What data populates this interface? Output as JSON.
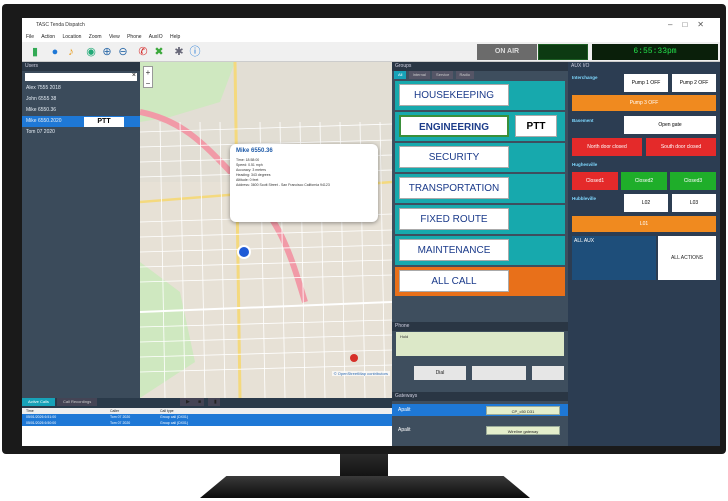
{
  "window": {
    "title": "TASC Tenda Dispatch"
  },
  "menu": [
    "File",
    "Action",
    "Location",
    "Zoom",
    "View",
    "Phone",
    "AuxIO",
    "Help"
  ],
  "toolbar": {
    "on_air": "ON AIR",
    "clock": "6:55:33pm"
  },
  "users": {
    "header": "Users",
    "items": [
      {
        "label": "Alex 7555 2018"
      },
      {
        "label": "John 6555 38"
      },
      {
        "label": "Mike 6550.36"
      },
      {
        "label": "Mike 6550.2020"
      },
      {
        "label": "Tom 07 2020"
      }
    ],
    "ptt_label": "PTT"
  },
  "map": {
    "popup_title": "Mike 6550.36",
    "popup_lines": [
      "Time: 18:58:00",
      "Speed: 0.51 mph",
      "Accuracy: 3 meters",
      "Heading: 343 degrees",
      "Altitude: 0 feet",
      "Address: 3600 Scott Street - San Francisco California 94123"
    ],
    "attribution": "© OpenStreetMap contributors"
  },
  "groups": {
    "header": "Groups",
    "tabs": [
      "All",
      "Internal",
      "Service",
      "Radio"
    ],
    "items": [
      {
        "label": "HOUSEKEEPING"
      },
      {
        "label": "ENGINEERING"
      },
      {
        "label": "SECURITY"
      },
      {
        "label": "TRANSPORTATION"
      },
      {
        "label": "FIXED ROUTE"
      },
      {
        "label": "MAINTENANCE"
      },
      {
        "label": "ALL CALL"
      }
    ],
    "ptt_label": "PTT"
  },
  "phone": {
    "header": "Phone",
    "text": "Hold",
    "dial": "Dial"
  },
  "gateways": {
    "header": "Gateways",
    "items": [
      {
        "label": "Apalit",
        "button": "CP_c50 D31"
      },
      {
        "label": "Apalit",
        "button": "Wireline gateway"
      }
    ]
  },
  "aux": {
    "header": "AUX I/O",
    "section1": "Interchange",
    "pump1": "Pump 1 OFF",
    "pump2": "Pump 2 OFF",
    "pump3": "Pump 3 OFF",
    "section2": "Basement",
    "open_gate": "Open gate",
    "north_door": "North door closed",
    "south_door": "South door closed",
    "section3": "Hughesville",
    "closed1": "Closed1",
    "closed2": "Closed2",
    "closed3": "Closed3",
    "section4": "Hubbleville",
    "l02": "L02",
    "l03": "L03",
    "l01": "L01",
    "all_aux": "ALL AUX",
    "all_actions": "ALL ACTIONS"
  },
  "calllog": {
    "tabs": [
      "Active Calls",
      "Call Recordings"
    ],
    "columns": [
      "Time",
      "Caller",
      "Call type"
    ],
    "rows": [
      {
        "time": "05/01/2026 6:51:00",
        "caller": "Tom 07 2020",
        "type": "Group call (DX01)"
      },
      {
        "time": "05/01/2026 6:50:00",
        "caller": "Tom 07 2020",
        "type": "Group call (DX01)"
      }
    ]
  },
  "colors": {
    "group_teal": "#17a9ad",
    "all_call_orange": "#e8701a",
    "selected_blue": "#1e78d6",
    "clock_green": "#23e24b"
  }
}
